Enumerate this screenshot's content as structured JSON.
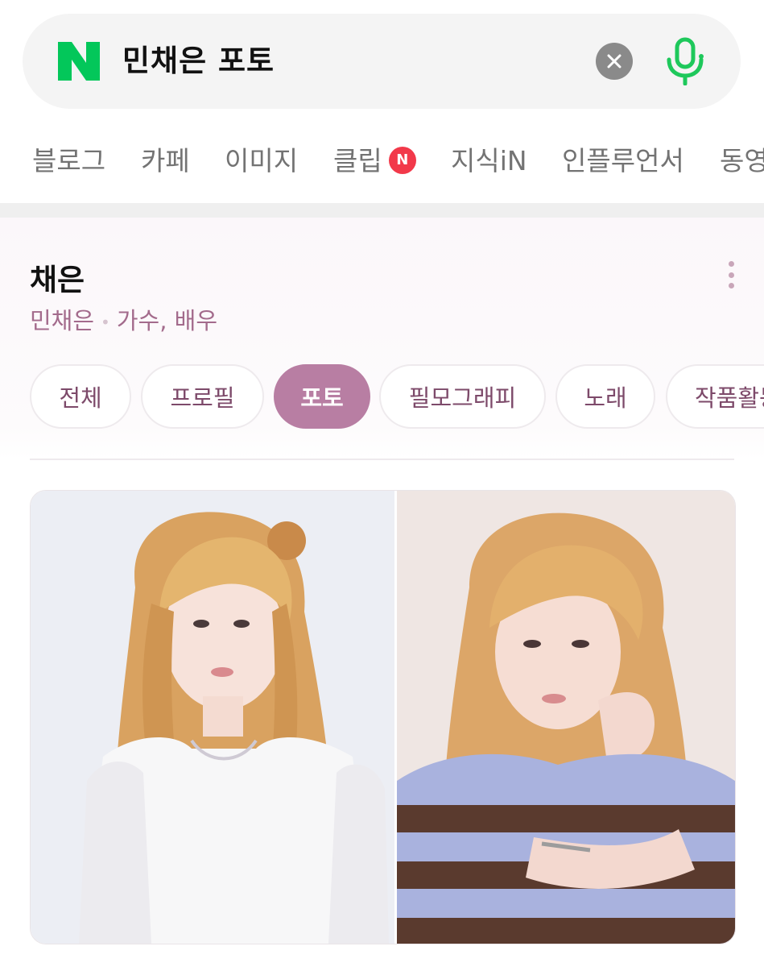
{
  "search": {
    "logo_text": "N",
    "query": "민채은 포토",
    "brand_color": "#03c75a"
  },
  "tabs": [
    {
      "label": "블로그"
    },
    {
      "label": "카페"
    },
    {
      "label": "이미지"
    },
    {
      "label": "클립",
      "badge": "N"
    },
    {
      "label": "지식iN"
    },
    {
      "label": "인플루언서"
    },
    {
      "label": "동영"
    }
  ],
  "panel": {
    "name": "채은",
    "real_name": "민채은",
    "occupation": "가수, 배우",
    "chips": [
      {
        "label": "전체",
        "active": false
      },
      {
        "label": "프로필",
        "active": false
      },
      {
        "label": "포토",
        "active": true
      },
      {
        "label": "필모그래피",
        "active": false
      },
      {
        "label": "노래",
        "active": false
      },
      {
        "label": "작품활동",
        "active": false
      }
    ],
    "accent_color": "#b87ea3"
  },
  "photos": [
    {
      "description_icon": "photo-white-lace-outfit"
    },
    {
      "description_icon": "photo-striped-sweater"
    }
  ]
}
